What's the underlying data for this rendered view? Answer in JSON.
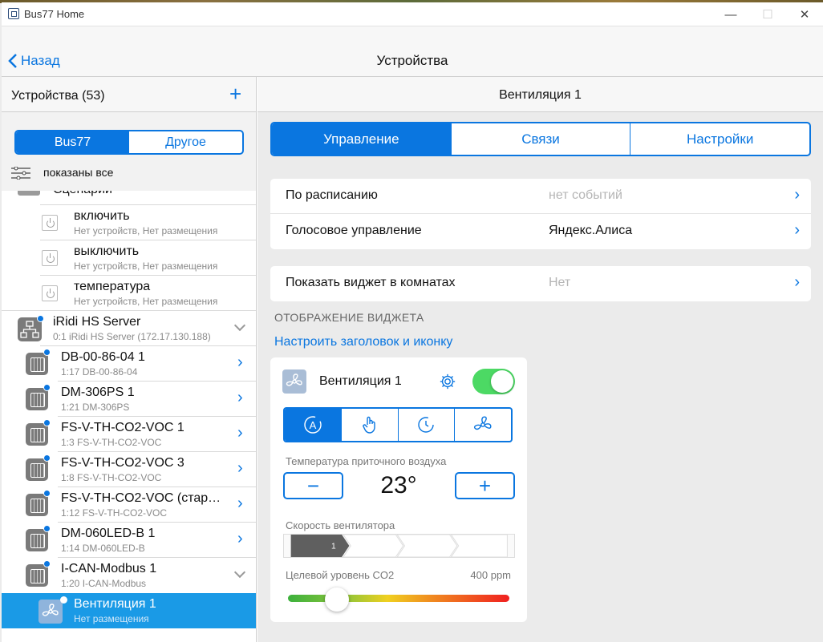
{
  "window": {
    "title": "Bus77 Home",
    "minimize": "—",
    "maximize": "☐",
    "close": "✕"
  },
  "nav": {
    "back_label": "Назад",
    "title": "Устройства"
  },
  "left": {
    "title": "Устройства (53)",
    "add": "+",
    "segments": [
      "Bus77",
      "Другое"
    ],
    "active_segment": 0,
    "filter_text": "показаны все",
    "scenes_header": "Сценарии",
    "items": [
      {
        "name": "включить",
        "sub": "Нет устройств, Нет размещения"
      },
      {
        "name": "выключить",
        "sub": "Нет устройств, Нет размещения"
      },
      {
        "name": "температура",
        "sub": "Нет устройств, Нет размещения"
      },
      {
        "name": "iRidi HS Server",
        "sub": "0:1 iRidi HS Server (172.17.130.188)"
      },
      {
        "name": "DB-00-86-04 1",
        "sub": "1:17 DB-00-86-04"
      },
      {
        "name": "DM-306PS 1",
        "sub": "1:21 DM-306PS"
      },
      {
        "name": "FS-V-TH-CO2-VOC 1",
        "sub": "1:3 FS-V-TH-CO2-VOC"
      },
      {
        "name": "FS-V-TH-CO2-VOC 3",
        "sub": "1:8 FS-V-TH-CO2-VOC"
      },
      {
        "name": "FS-V-TH-CO2-VOC (стар…",
        "sub": "1:12 FS-V-TH-CO2-VOC"
      },
      {
        "name": "DM-060LED-B 1",
        "sub": "1:14 DM-060LED-B"
      },
      {
        "name": "I-CAN-Modbus 1",
        "sub": "1:20 I-CAN-Modbus"
      },
      {
        "name": "Вентиляция 1",
        "sub": "Нет размещения"
      }
    ]
  },
  "right": {
    "title": "Вентиляция 1",
    "tabs": [
      "Управление",
      "Связи",
      "Настройки"
    ],
    "active_tab": 0,
    "schedule": {
      "label": "По расписанию",
      "value": "нет событий"
    },
    "voice": {
      "label": "Голосовое управление",
      "value": "Яндекс.Алиса"
    },
    "widget_in_rooms": {
      "label": "Показать виджет в комнатах",
      "value": "Нет"
    },
    "section_label": "ОТОБРАЖЕНИЕ ВИДЖЕТА",
    "configure_link": "Настроить заголовок и иконку",
    "widget": {
      "name": "Вентиляция 1",
      "power_on": true,
      "modes": [
        "auto-mode-icon",
        "hand-mode-icon",
        "timer-mode-icon",
        "fan-mode-icon"
      ],
      "active_mode": 0,
      "temp_label": "Температура приточного воздуха",
      "temp_value": "23°",
      "minus": "−",
      "plus": "+",
      "speed_label": "Скорость вентилятора",
      "speed_current": "1",
      "speed_steps": 4,
      "co2_label": "Целевой уровень CO2",
      "co2_value": "400 ppm",
      "co2_level": 0.22
    }
  },
  "colors": {
    "accent": "#0a76e0",
    "selected": "#1a9ae6",
    "toggle_on": "#4cd964"
  }
}
